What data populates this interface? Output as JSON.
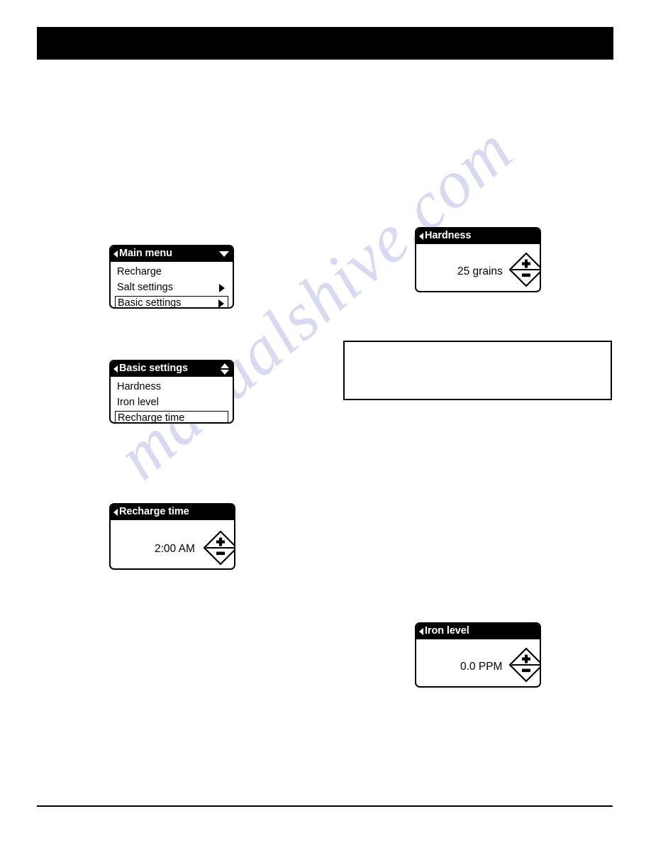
{
  "page": {
    "header_bar": "",
    "callout_box_text": "",
    "watermark": "manualshive.com"
  },
  "screens": [
    {
      "id": "main-menu",
      "kind": "list",
      "title": "Main menu",
      "title_back_icon": "back-arrow-icon",
      "title_scroll_icon": "chevron-down-icon",
      "rows": [
        {
          "label": "Recharge",
          "arrow": false,
          "selected": false
        },
        {
          "label": "Salt settings",
          "arrow": true,
          "selected": false
        },
        {
          "label": "Basic settings",
          "arrow": true,
          "selected": true
        }
      ]
    },
    {
      "id": "basic-settings",
      "kind": "list",
      "title": "Basic settings",
      "title_back_icon": "back-arrow-icon",
      "title_scroll_icon": "chevron-up-down-icon",
      "rows": [
        {
          "label": "Hardness",
          "arrow": false,
          "selected": false
        },
        {
          "label": "Iron level",
          "arrow": false,
          "selected": false
        },
        {
          "label": "Recharge time",
          "arrow": false,
          "selected": true
        }
      ]
    },
    {
      "id": "recharge-time",
      "kind": "value",
      "title": "Recharge time",
      "title_back_icon": "back-arrow-icon",
      "value": "2:00 AM",
      "plus_label": "+",
      "minus_label": "−"
    },
    {
      "id": "hardness",
      "kind": "value",
      "title": "Hardness",
      "title_back_icon": "back-arrow-icon",
      "value": "25 grains",
      "plus_label": "+",
      "minus_label": "−"
    },
    {
      "id": "iron-level",
      "kind": "value",
      "title": "Iron level",
      "title_back_icon": "back-arrow-icon",
      "value": "0.0 PPM",
      "plus_label": "+",
      "minus_label": "−"
    }
  ],
  "colors": {
    "ink": "#000000",
    "paper": "#ffffff",
    "watermark": "#b9bce6"
  }
}
